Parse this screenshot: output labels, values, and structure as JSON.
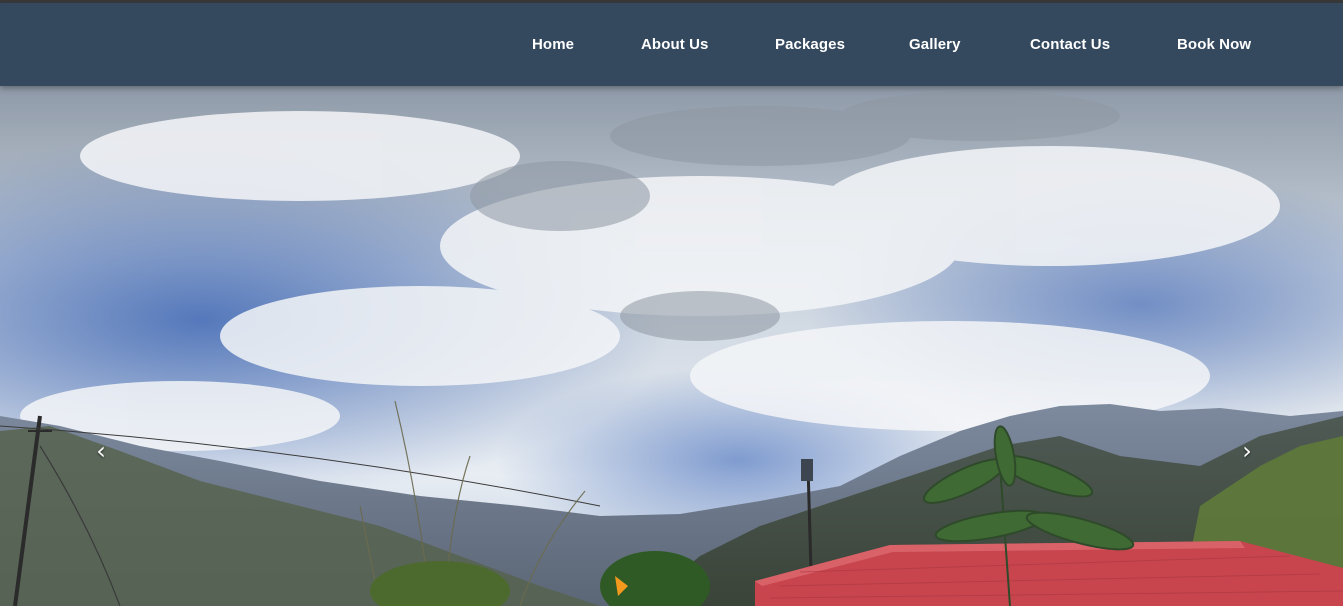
{
  "nav": {
    "items": [
      {
        "label": "Home"
      },
      {
        "label": "About Us"
      },
      {
        "label": "Packages"
      },
      {
        "label": "Gallery"
      },
      {
        "label": "Contact Us"
      },
      {
        "label": "Book Now"
      }
    ]
  },
  "carousel": {
    "prev_icon": "chevron-left-icon",
    "next_icon": "chevron-right-icon"
  },
  "colors": {
    "navbar": "#34495e",
    "nav_text": "#ffffff",
    "roof": "#c8454e"
  }
}
